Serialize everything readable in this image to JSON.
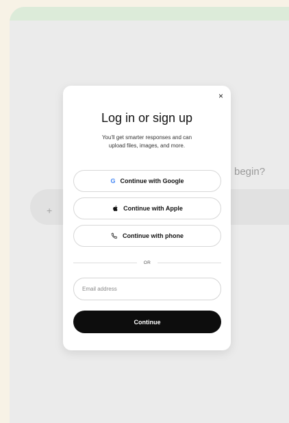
{
  "background": {
    "question_fragment": "begin?",
    "input_plus": "+"
  },
  "modal": {
    "close_glyph": "×",
    "title": "Log in or sign up",
    "subtitle_line1": "You'll get smarter responses and can",
    "subtitle_line2": "upload files, images, and more.",
    "buttons": [
      {
        "label": "Continue with Google",
        "icon": "google-icon"
      },
      {
        "label": "Continue with Apple",
        "icon": "apple-icon"
      },
      {
        "label": "Continue with phone",
        "icon": "phone-icon"
      }
    ],
    "divider_text": "OR",
    "email_placeholder": "Email address",
    "continue_label": "Continue"
  },
  "colors": {
    "page_bg": "#f7f2e6",
    "content_bg": "#ebebeb",
    "top_strip": "#dcebd9",
    "primary_button": "#0d0d0d",
    "google_g": "#4285f4"
  }
}
